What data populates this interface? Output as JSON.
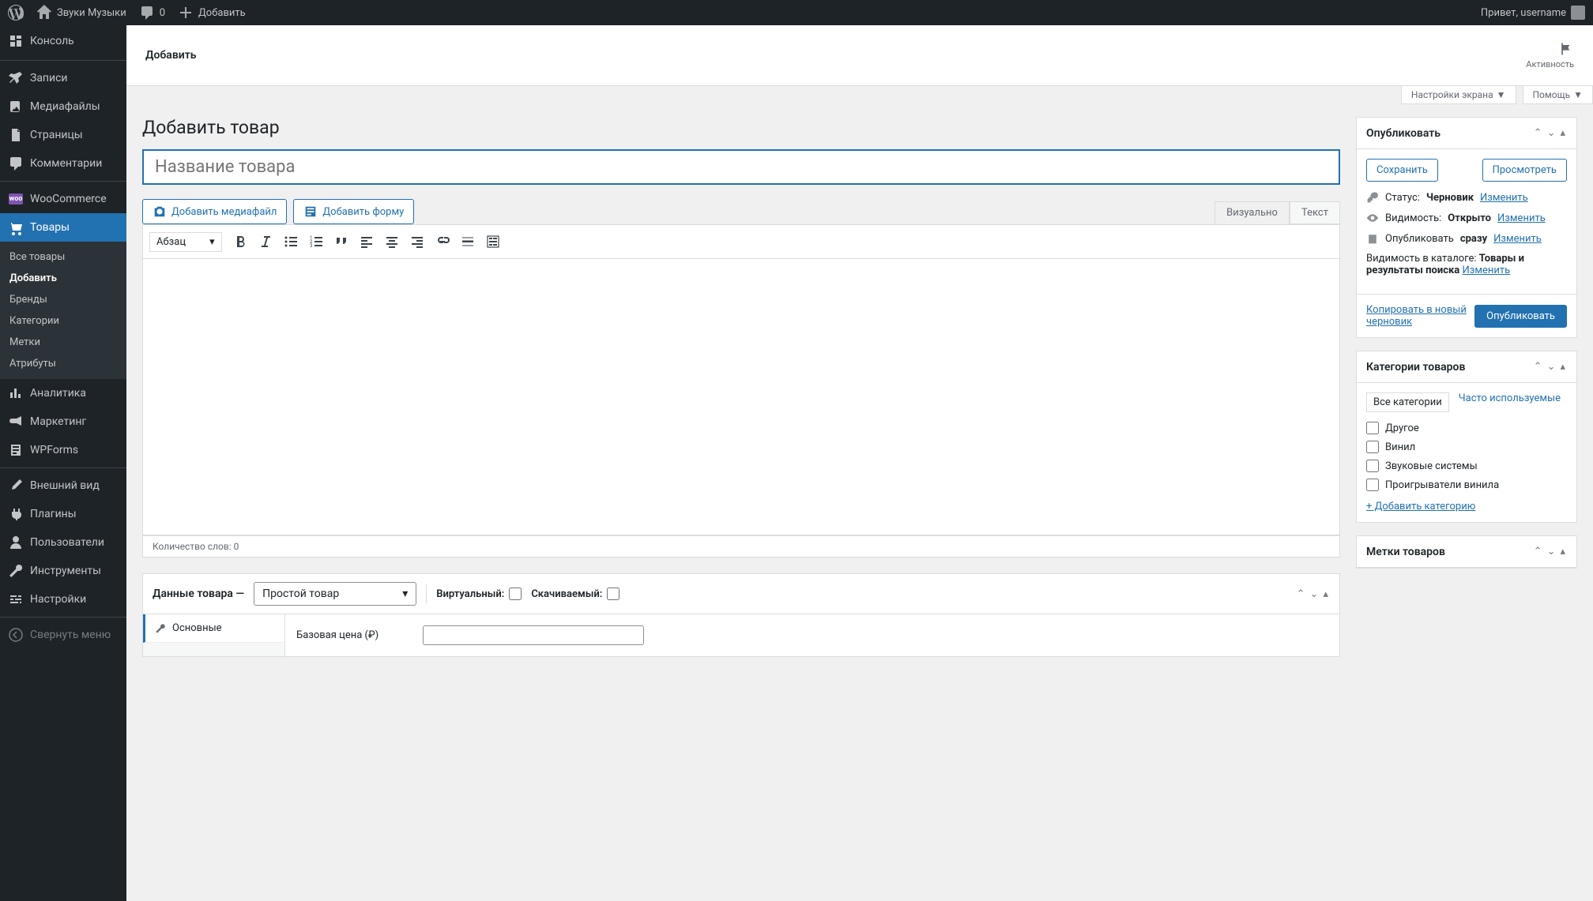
{
  "adminbar": {
    "site_name": "Звуки Музыки",
    "comments_count": "0",
    "add_new": "Добавить",
    "greeting": "Привет, username"
  },
  "sidebar": {
    "dashboard": "Консоль",
    "posts": "Записи",
    "media": "Медиафайлы",
    "pages": "Страницы",
    "comments": "Комментарии",
    "woocommerce": "WooCommerce",
    "products": "Товары",
    "submenu": {
      "all": "Все товары",
      "add": "Добавить",
      "brands": "Бренды",
      "categories": "Категории",
      "tags": "Метки",
      "attributes": "Атрибуты"
    },
    "analytics": "Аналитика",
    "marketing": "Маркетинг",
    "wpforms": "WPForms",
    "appearance": "Внешний вид",
    "plugins": "Плагины",
    "users": "Пользователи",
    "tools": "Инструменты",
    "settings": "Настройки",
    "collapse": "Свернуть меню"
  },
  "header": {
    "title": "Добавить",
    "activity": "Активность"
  },
  "screen_meta": {
    "screen_options": "Настройки экрана",
    "help": "Помощь"
  },
  "page": {
    "title": "Добавить товар",
    "product_name_placeholder": "Название товара"
  },
  "editor": {
    "add_media": "Добавить медиафайл",
    "add_form": "Добавить форму",
    "tab_visual": "Визуально",
    "tab_text": "Текст",
    "format": "Абзац",
    "word_count_label": "Количество слов: 0"
  },
  "publish": {
    "title": "Опубликовать",
    "save": "Сохранить",
    "preview": "Просмотреть",
    "status_label": "Статус:",
    "status_value": "Черновик",
    "visibility_label": "Видимость:",
    "visibility_value": "Открыто",
    "publish_label": "Опубликовать",
    "publish_value": "сразу",
    "catalog_label": "Видимость в каталоге:",
    "catalog_value": "Товары и результаты поиска",
    "change": "Изменить",
    "copy_draft": "Копировать в новый черновик",
    "publish_btn": "Опубликовать"
  },
  "categories": {
    "title": "Категории товаров",
    "tab_all": "Все категории",
    "tab_popular": "Часто используемые",
    "items": [
      "Другое",
      "Винил",
      "Звуковые системы",
      "Проигрыватели винила"
    ],
    "add_new": "+ Добавить категорию"
  },
  "tags": {
    "title": "Метки товаров"
  },
  "product_data": {
    "title": "Данные товара —",
    "type": "Простой товар",
    "virtual": "Виртуальный:",
    "downloadable": "Скачиваемый:",
    "tab_general": "Основные",
    "price_label": "Базовая цена (₽)"
  }
}
